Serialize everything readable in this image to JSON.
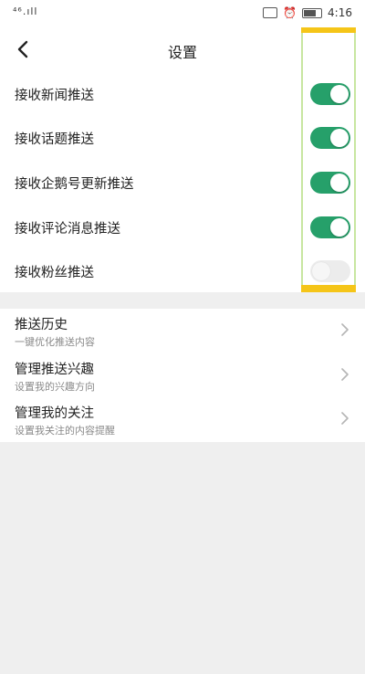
{
  "status_bar": {
    "signal": "⁴⁶.ıll",
    "time": "4:16"
  },
  "header": {
    "title": "设置"
  },
  "toggles": [
    {
      "label": "接收新闻推送",
      "enabled": true
    },
    {
      "label": "接收话题推送",
      "enabled": true
    },
    {
      "label": "接收企鹅号更新推送",
      "enabled": true
    },
    {
      "label": "接收评论消息推送",
      "enabled": true
    },
    {
      "label": "接收粉丝推送",
      "enabled": false
    }
  ],
  "links": [
    {
      "title": "推送历史",
      "subtitle": "一键优化推送内容"
    },
    {
      "title": "管理推送兴趣",
      "subtitle": "设置我的兴趣方向"
    },
    {
      "title": "管理我的关注",
      "subtitle": "设置我关注的内容提醒"
    }
  ],
  "colors": {
    "switch_on": "#26a06a",
    "highlight": "#f5c518"
  }
}
